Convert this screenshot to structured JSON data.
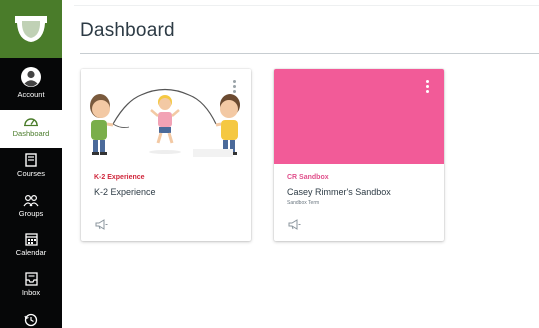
{
  "page": {
    "title": "Dashboard"
  },
  "nav": {
    "brand_color": "#4a7c2a",
    "background_color": "#060708",
    "items": [
      {
        "label": "Account",
        "icon": "user-avatar-icon"
      },
      {
        "label": "Dashboard",
        "icon": "dashboard-gauge-icon",
        "active": true
      },
      {
        "label": "Courses",
        "icon": "book-icon"
      },
      {
        "label": "Groups",
        "icon": "groups-icon"
      },
      {
        "label": "Calendar",
        "icon": "calendar-icon"
      },
      {
        "label": "Inbox",
        "icon": "inbox-icon"
      },
      {
        "label": "",
        "icon": "history-icon"
      }
    ]
  },
  "cards": [
    {
      "code": "K-2 Experience",
      "title": "K-2 Experience",
      "term": "",
      "code_color": "#d0273c",
      "hero": "jump-rope-kids-illustration",
      "icon": "announcements-megaphone-icon"
    },
    {
      "code": "CR Sandbox",
      "title": "Casey Rimmer's Sandbox",
      "term": "Sandbox Term",
      "code_color": "#e1508c",
      "hero_color": "#f25b98",
      "icon": "announcements-megaphone-icon",
      "menu_icon": "kebab-menu-icon"
    }
  ]
}
